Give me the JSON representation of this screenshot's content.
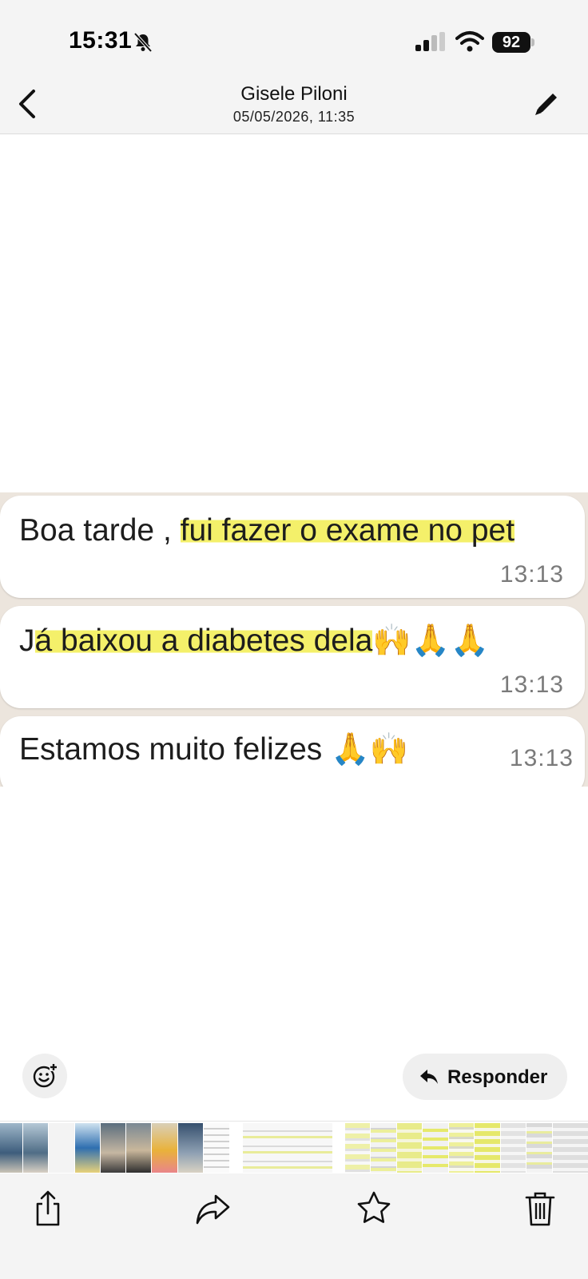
{
  "status_bar": {
    "time": "15:31",
    "battery": "92",
    "icons": [
      "bell-off-icon",
      "signal-icon",
      "wifi-icon",
      "battery-icon"
    ]
  },
  "header": {
    "title": "Gisele Piloni",
    "subtitle": "05/05/2026, 11:35",
    "back_icon": "chevron-left-icon",
    "edit_icon": "pencil-icon"
  },
  "messages": [
    {
      "plain": "Boa tarde , ",
      "highlight": "fui fazer o exame no pet",
      "time": "13:13"
    },
    {
      "plain": "J",
      "highlight": "á baixou a diabetes dela",
      "emoji": "🙌🙏🙏",
      "time": "13:13"
    },
    {
      "plain": "Estamos muito felizes ",
      "emoji": "🙏🙌",
      "time": "13:13"
    }
  ],
  "actions": {
    "reply_label": "Responder",
    "reaction_icon": "emoji-add-icon",
    "reply_icon": "reply-arrow-icon"
  },
  "toolbar": {
    "icons": [
      "share-icon",
      "forward-icon",
      "star-icon",
      "trash-icon"
    ]
  },
  "colors": {
    "highlight": "#f4f06a",
    "chat_background": "#ece5dd",
    "bar_background": "#f4f4f4"
  }
}
